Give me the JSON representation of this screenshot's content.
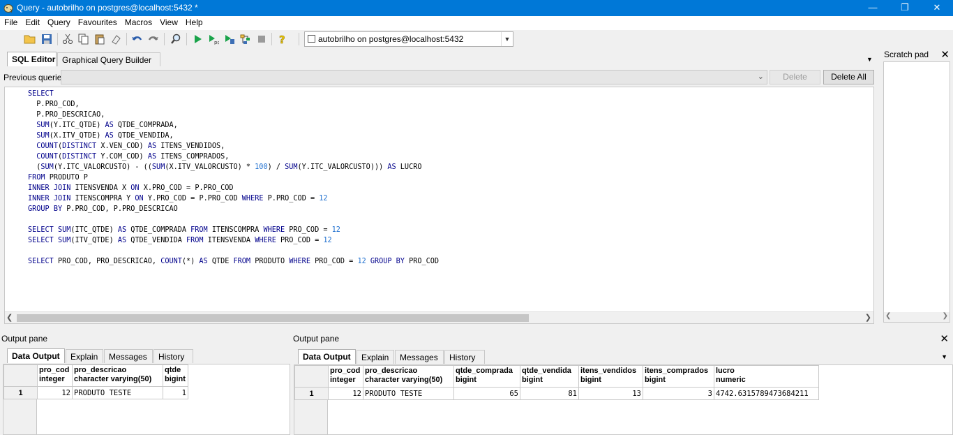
{
  "window": {
    "title": "Query - autobrilho on postgres@localhost:5432 *",
    "minimize": "—",
    "maximize": "❐",
    "close": "✕"
  },
  "menu": [
    "File",
    "Edit",
    "Query",
    "Favourites",
    "Macros",
    "View",
    "Help"
  ],
  "toolbar": {
    "connection": "autobrilho on postgres@localhost:5432"
  },
  "editor_tabs": [
    "SQL Editor",
    "Graphical Query Builder"
  ],
  "previous_queries": {
    "label": "Previous queries",
    "delete": "Delete",
    "delete_all": "Delete All"
  },
  "sql_lines": [
    "SELECT",
    "  P.PRO_COD,",
    "  P.PRO_DESCRICAO,",
    "  SUM(Y.ITC_QTDE) AS QTDE_COMPRADA,",
    "  SUM(X.ITV_QTDE) AS QTDE_VENDIDA,",
    "  COUNT(DISTINCT X.VEN_COD) AS ITENS_VENDIDOS,",
    "  COUNT(DISTINCT Y.COM_COD) AS ITENS_COMPRADOS,",
    "  (SUM(Y.ITC_VALORCUSTO) - ((SUM(X.ITV_VALORCUSTO) * 100) / SUM(Y.ITC_VALORCUSTO))) AS LUCRO",
    "FROM PRODUTO P",
    "INNER JOIN ITENSVENDA X ON X.PRO_COD = P.PRO_COD",
    "INNER JOIN ITENSCOMPRA Y ON Y.PRO_COD = P.PRO_COD WHERE P.PRO_COD = 12",
    "GROUP BY P.PRO_COD, P.PRO_DESCRICAO",
    "",
    "SELECT SUM(ITC_QTDE) AS QTDE_COMPRADA FROM ITENSCOMPRA WHERE PRO_COD = 12",
    "SELECT SUM(ITV_QTDE) AS QTDE_VENDIDA FROM ITENSVENDA WHERE PRO_COD = 12",
    "",
    "SELECT PRO_COD, PRO_DESCRICAO, COUNT(*) AS QTDE FROM PRODUTO WHERE PRO_COD = 12 GROUP BY PRO_COD"
  ],
  "scratch_pad": {
    "title": "Scratch pad",
    "close": "✕"
  },
  "output_left": {
    "title": "Output pane",
    "tabs": [
      "Data Output",
      "Explain",
      "Messages",
      "History"
    ],
    "columns": [
      {
        "name": "pro_cod",
        "type": "integer"
      },
      {
        "name": "pro_descricao",
        "type": "character varying(50)"
      },
      {
        "name": "qtde",
        "type": "bigint"
      }
    ],
    "rows": [
      [
        "1",
        "12",
        "PRODUTO TESTE",
        "1"
      ]
    ]
  },
  "output_right": {
    "title": "Output pane",
    "close": "✕",
    "tabs": [
      "Data Output",
      "Explain",
      "Messages",
      "History"
    ],
    "columns": [
      {
        "name": "pro_cod",
        "type": "integer"
      },
      {
        "name": "pro_descricao",
        "type": "character varying(50)"
      },
      {
        "name": "qtde_comprada",
        "type": "bigint"
      },
      {
        "name": "qtde_vendida",
        "type": "bigint"
      },
      {
        "name": "itens_vendidos",
        "type": "bigint"
      },
      {
        "name": "itens_comprados",
        "type": "bigint"
      },
      {
        "name": "lucro",
        "type": "numeric"
      }
    ],
    "rows": [
      [
        "1",
        "12",
        "PRODUTO TESTE",
        "65",
        "81",
        "13",
        "3",
        "4742.6315789473684211"
      ]
    ]
  }
}
